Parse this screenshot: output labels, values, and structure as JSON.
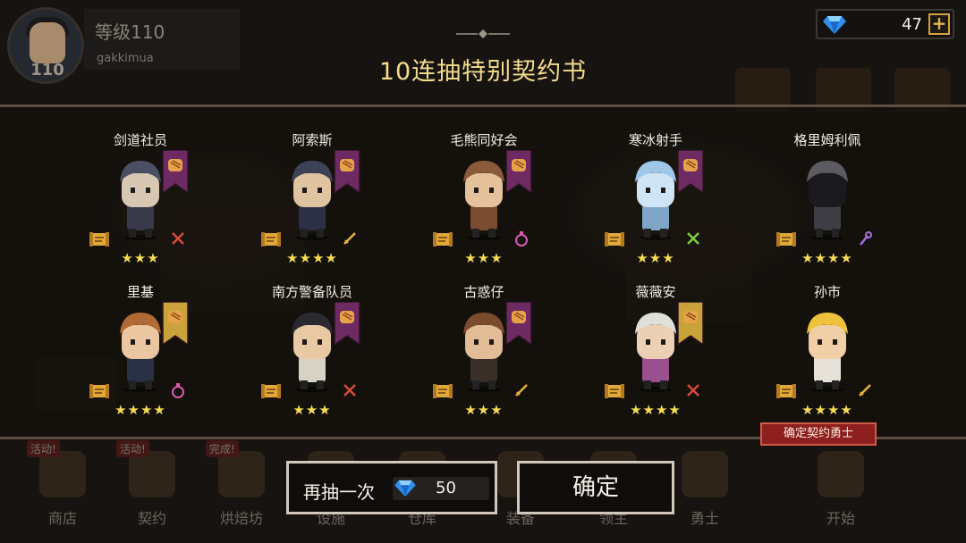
{
  "player": {
    "level_label": "等级110",
    "username": "gakkimua",
    "avatar_level": "110"
  },
  "currency": {
    "gems": "47",
    "plus": "+"
  },
  "title": "10连抽特别契约书",
  "cards": [
    {
      "name": "剑道社员",
      "stars": "★★★",
      "banner": "purple",
      "weapon": "crossed-swords-icon"
    },
    {
      "name": "阿索斯",
      "stars": "★★★★",
      "banner": "purple",
      "weapon": "sword-icon"
    },
    {
      "name": "毛熊同好会",
      "stars": "★★★",
      "banner": "purple",
      "weapon": "potion-icon"
    },
    {
      "name": "寒冰射手",
      "stars": "★★★",
      "banner": "purple",
      "weapon": "cross-arrow-icon"
    },
    {
      "name": "格里姆利佩",
      "stars": "★★★★",
      "banner": "none",
      "weapon": "staff-icon"
    },
    {
      "name": "里基",
      "stars": "★★★★",
      "banner": "gold",
      "weapon": "potion-icon"
    },
    {
      "name": "南方警备队员",
      "stars": "★★★",
      "banner": "purple",
      "weapon": "crossed-swords-icon"
    },
    {
      "name": "古惑仔",
      "stars": "★★★",
      "banner": "purple",
      "weapon": "sword-icon"
    },
    {
      "name": "薇薇安",
      "stars": "★★★★",
      "banner": "gold",
      "weapon": "crossed-swords-icon"
    },
    {
      "name": "孙市",
      "stars": "★★★★",
      "banner": "none",
      "weapon": "sword-icon"
    }
  ],
  "confirm_tag": "确定契约勇士",
  "buttons": {
    "draw_again": "再抽一次",
    "draw_again_cost": "50",
    "confirm": "确定"
  },
  "nav": [
    {
      "label": "商店",
      "badge": "活动!"
    },
    {
      "label": "契约",
      "badge": "活动!"
    },
    {
      "label": "烘焙坊",
      "badge": "完成!"
    },
    {
      "label": "设施",
      "badge": ""
    },
    {
      "label": "仓库",
      "badge": ""
    },
    {
      "label": "装备",
      "badge": ""
    },
    {
      "label": "领主",
      "badge": ""
    },
    {
      "label": "勇士",
      "badge": ""
    },
    {
      "label": "开始",
      "badge": ""
    }
  ],
  "colors": {
    "title": "#f3dc8e",
    "stars": "#f5dc55",
    "banner_purple": "#6e2a63",
    "banner_gold": "#c9a23a",
    "confirm_tag": "#8e1f1f"
  }
}
